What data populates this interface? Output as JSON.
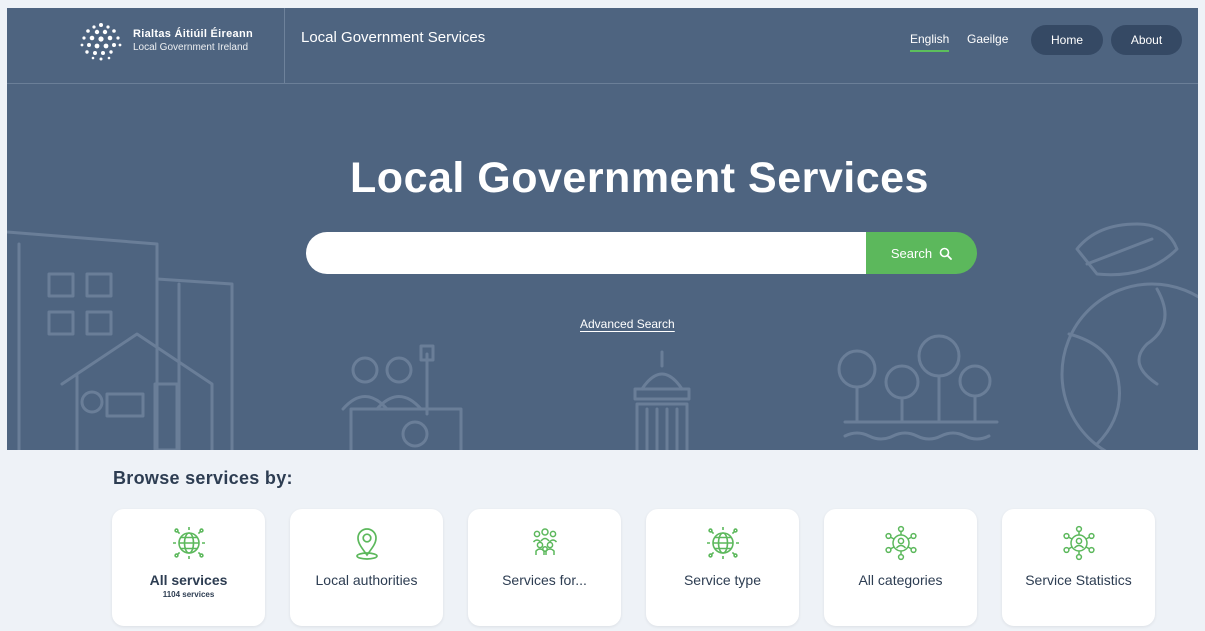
{
  "header": {
    "logo_line1": "Rialtas Áitiúil Éireann",
    "logo_line2": "Local Government Ireland",
    "site_name": "Local Government Services",
    "lang_english": "English",
    "lang_irish": "Gaeilge",
    "nav_home": "Home",
    "nav_about": "About"
  },
  "hero": {
    "title": "Local Government Services",
    "search_value": "",
    "search_button": "Search",
    "advanced_search": "Advanced Search"
  },
  "browse": {
    "title": "Browse services by:",
    "cards": [
      {
        "label": "All services",
        "sub": "1104 services",
        "icon": "globe-icon"
      },
      {
        "label": "Local authorities",
        "icon": "location-pin-icon"
      },
      {
        "label": "Services for...",
        "icon": "people-group-icon"
      },
      {
        "label": "Service type",
        "icon": "globe-icon"
      },
      {
        "label": "All categories",
        "icon": "network-user-icon"
      },
      {
        "label": "Service Statistics",
        "icon": "network-user-icon"
      }
    ]
  },
  "colors": {
    "header_bg": "#4e6480",
    "accent_green": "#5cb85c",
    "nav_button_bg": "#354964",
    "page_bg": "#eef2f7",
    "text_dark": "#2d3d52"
  }
}
